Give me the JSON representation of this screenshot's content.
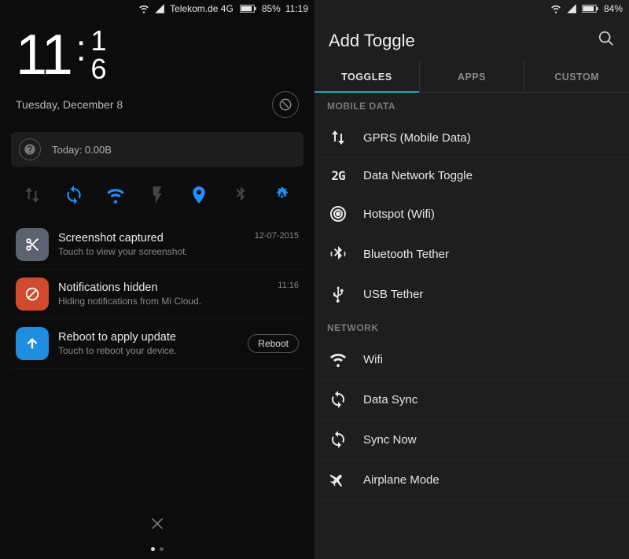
{
  "left": {
    "status": {
      "carrier": "Telekom.de 4G",
      "battery": "85%",
      "time": "11:19"
    },
    "clock": {
      "hours": "11",
      "m1": "1",
      "m2": "6"
    },
    "date": "Tuesday, December 8",
    "usage_label": "Today: 0.00B",
    "toggles": [
      {
        "name": "data-arrows",
        "on": false
      },
      {
        "name": "sync",
        "on": true
      },
      {
        "name": "wifi",
        "on": true
      },
      {
        "name": "flash",
        "on": false
      },
      {
        "name": "location",
        "on": true
      },
      {
        "name": "bluetooth",
        "on": false
      },
      {
        "name": "auto-brightness",
        "on": true
      }
    ],
    "notifications": [
      {
        "icon": "scissors",
        "icon_bg": "#5b6270",
        "title": "Screenshot captured",
        "sub": "Touch to view your screenshot.",
        "time": "12-07-2015",
        "action": null
      },
      {
        "icon": "deny",
        "icon_bg": "#d14a2e",
        "title": "Notifications hidden",
        "sub": "Hiding notifications from Mi Cloud.",
        "time": "11:16",
        "action": null
      },
      {
        "icon": "arrow-up",
        "icon_bg": "#1f8ee0",
        "title": "Reboot to apply update",
        "sub": "Touch to reboot your device.",
        "time": null,
        "action": "Reboot"
      }
    ]
  },
  "right": {
    "status": {
      "battery": "84%"
    },
    "title": "Add Toggle",
    "tabs": [
      {
        "label": "TOGGLES",
        "active": true
      },
      {
        "label": "APPS",
        "active": false
      },
      {
        "label": "CUSTOM",
        "active": false
      }
    ],
    "sections": [
      {
        "header": "MOBILE DATA",
        "items": [
          {
            "icon": "updown",
            "label": "GPRS (Mobile Data)"
          },
          {
            "icon": "2g",
            "label": "Data Network Toggle"
          },
          {
            "icon": "hotspot",
            "label": "Hotspot (Wifi)"
          },
          {
            "icon": "bt-tether",
            "label": "Bluetooth Tether"
          },
          {
            "icon": "usb",
            "label": "USB Tether"
          }
        ]
      },
      {
        "header": "NETWORK",
        "items": [
          {
            "icon": "wifi",
            "label": "Wifi"
          },
          {
            "icon": "sync",
            "label": "Data Sync"
          },
          {
            "icon": "sync",
            "label": "Sync Now"
          },
          {
            "icon": "airplane",
            "label": "Airplane Mode"
          }
        ]
      }
    ]
  }
}
